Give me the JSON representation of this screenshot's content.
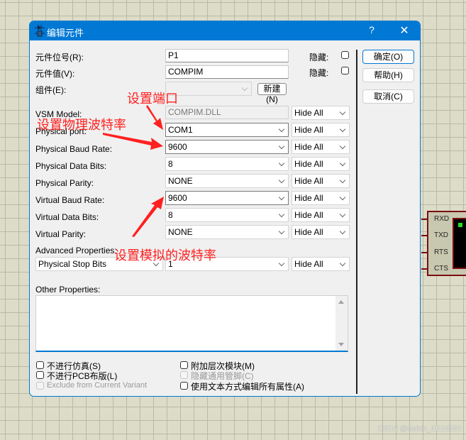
{
  "dialog": {
    "title": "编辑元件",
    "help_label": "?",
    "close_label": "✕",
    "buttons": {
      "ok": "确定(O)",
      "help": "帮助(H)",
      "cancel": "取消(C)"
    }
  },
  "top_fields": {
    "part_ref_label": "元件位号(R):",
    "part_ref_value": "P1",
    "part_value_label": "元件值(V):",
    "part_value_value": "COMPIM",
    "hidden_label": "隐藏:",
    "component_label": "组件(E):",
    "component_value": "",
    "new_button": "新建(N)"
  },
  "properties": [
    {
      "label": "VSM Model:",
      "value": "COMPIM.DLL",
      "visibility": "Hide All",
      "type": "text-disabled"
    },
    {
      "label": "Physical port:",
      "value": "COM1",
      "visibility": "Hide All",
      "type": "select"
    },
    {
      "label": "Physical Baud Rate:",
      "value": "9600",
      "visibility": "Hide All",
      "type": "select"
    },
    {
      "label": "Physical Data Bits:",
      "value": "8",
      "visibility": "Hide All",
      "type": "select"
    },
    {
      "label": "Physical Parity:",
      "value": "NONE",
      "visibility": "Hide All",
      "type": "select"
    },
    {
      "label": "Virtual Baud Rate:",
      "value": "9600",
      "visibility": "Hide All",
      "type": "select"
    },
    {
      "label": "Virtual Data Bits:",
      "value": "8",
      "visibility": "Hide All",
      "type": "select"
    },
    {
      "label": "Virtual Parity:",
      "value": "NONE",
      "visibility": "Hide All",
      "type": "select"
    }
  ],
  "advanced": {
    "label": "Advanced Properties:",
    "property": "Physical Stop Bits",
    "value": "1",
    "visibility": "Hide All"
  },
  "other_properties": {
    "label": "Other Properties:",
    "value": ""
  },
  "options": {
    "exclude_sim": "不进行仿真(S)",
    "exclude_pcb": "不进行PCB布版(L)",
    "exclude_variant": "Exclude from Current Variant",
    "attach_hierarchy": "附加层次模块(M)",
    "hide_common_pins": "隐藏通用管脚(C)",
    "edit_all_as_text": "使用文本方式编辑所有属性(A)"
  },
  "annotations": {
    "set_port": "设置端口",
    "set_physical_baud": "设置物理波特率",
    "set_virtual_baud": "设置模拟的波特率",
    "color": "#ff2020"
  },
  "schematic": {
    "pins": [
      "RXD",
      "TXD",
      "RTS",
      "CTS"
    ],
    "led_color": "#22dd22"
  },
  "watermark": "CSDN @weixin_51102592",
  "accent_color": "#0078d4"
}
